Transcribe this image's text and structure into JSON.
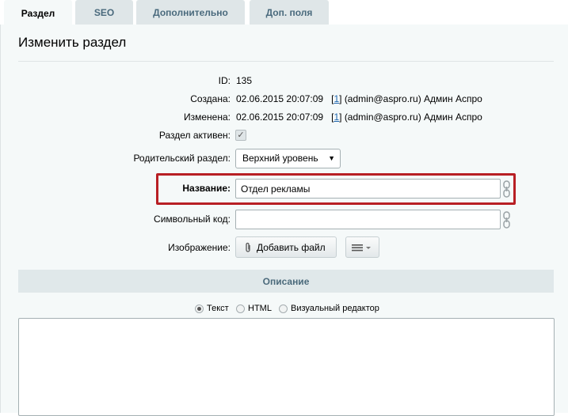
{
  "tabs": [
    {
      "label": "Раздел",
      "active": true
    },
    {
      "label": "SEO",
      "active": false
    },
    {
      "label": "Дополнительно",
      "active": false
    },
    {
      "label": "Доп. поля",
      "active": false
    }
  ],
  "page": {
    "title": "Изменить раздел"
  },
  "fields": {
    "id": {
      "label": "ID:",
      "value": "135"
    },
    "created": {
      "label": "Создана:",
      "date": "02.06.2015 20:07:09",
      "user_link": "1",
      "user_info": "(admin@aspro.ru) Админ Аспро"
    },
    "modified": {
      "label": "Изменена:",
      "date": "02.06.2015 20:07:09",
      "user_link": "1",
      "user_info": "(admin@aspro.ru) Админ Аспро"
    },
    "active": {
      "label": "Раздел активен:",
      "checked": true
    },
    "parent": {
      "label": "Родительский раздел:",
      "value": "Верхний уровень"
    },
    "name": {
      "label": "Название:",
      "value": "Отдел рекламы"
    },
    "code": {
      "label": "Символьный код:",
      "value": ""
    },
    "image": {
      "label": "Изображение:",
      "button_label": "Добавить файл"
    }
  },
  "description": {
    "header": "Описание",
    "modes": [
      {
        "label": "Текст",
        "checked": true
      },
      {
        "label": "HTML",
        "checked": false
      },
      {
        "label": "Визуальный редактор",
        "checked": false
      }
    ]
  },
  "icons": {
    "checkmark": "✓",
    "dropdown_arrow": "▼"
  },
  "colors": {
    "highlight": "#b81f24",
    "link": "#2067b0",
    "panel_bg": "#f5f9f9",
    "tab_bg": "#dfe6e8"
  }
}
